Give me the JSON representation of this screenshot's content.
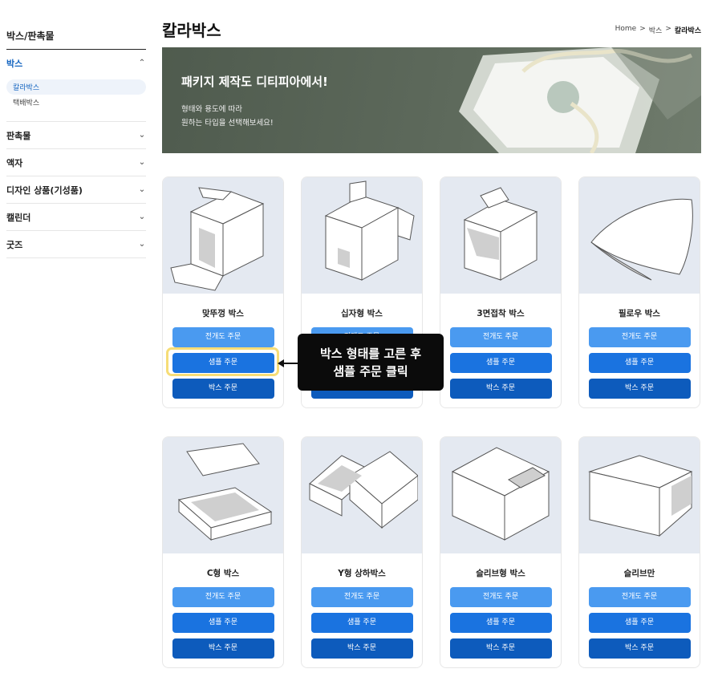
{
  "sidebar": {
    "title": "박스/판촉물",
    "sections": [
      {
        "label": "박스",
        "expanded": true,
        "items": [
          {
            "label": "칼라박스",
            "selected": true
          },
          {
            "label": "택배박스",
            "selected": false
          }
        ]
      },
      {
        "label": "판촉물"
      },
      {
        "label": "액자"
      },
      {
        "label": "디자인 상품(기성품)"
      },
      {
        "label": "캘린더"
      },
      {
        "label": "굿즈"
      }
    ]
  },
  "main": {
    "title": "칼라박스",
    "breadcrumb": [
      "Home",
      "박스",
      "칼라박스"
    ],
    "breadcrumb_sep": ">",
    "banner": {
      "heading": "패키지 제작도 디티피아에서!",
      "line1": "형태와 용도에 따라",
      "line2": "원하는 타입을 선택해보세요!"
    },
    "buttons": {
      "a": "전개도 주문",
      "b": "샘플 주문",
      "c": "박스 주문"
    },
    "products": [
      {
        "name": "맞뚜껑 박스",
        "icon": "tuck-box-icon"
      },
      {
        "name": "십자형 박스",
        "icon": "cross-box-icon"
      },
      {
        "name": "3면접착 박스",
        "icon": "three-side-box-icon"
      },
      {
        "name": "필로우 박스",
        "icon": "pillow-box-icon"
      },
      {
        "name": "C형 박스",
        "icon": "c-type-box-icon"
      },
      {
        "name": "Y형 상하박스",
        "icon": "lid-base-box-icon"
      },
      {
        "name": "슬리브형 박스",
        "icon": "sleeve-drawer-box-icon"
      },
      {
        "name": "슬리브만",
        "icon": "sleeve-only-icon"
      }
    ]
  },
  "callout": {
    "line1": "박스 형태를 고른 후",
    "line2": "샘플 주문 클릭"
  },
  "colors": {
    "accent": "#1565c0",
    "btn_light": "#4a9af0",
    "btn_mid": "#1a73e0",
    "btn_dark": "#0d5bbc",
    "highlight": "#f6dd77"
  }
}
